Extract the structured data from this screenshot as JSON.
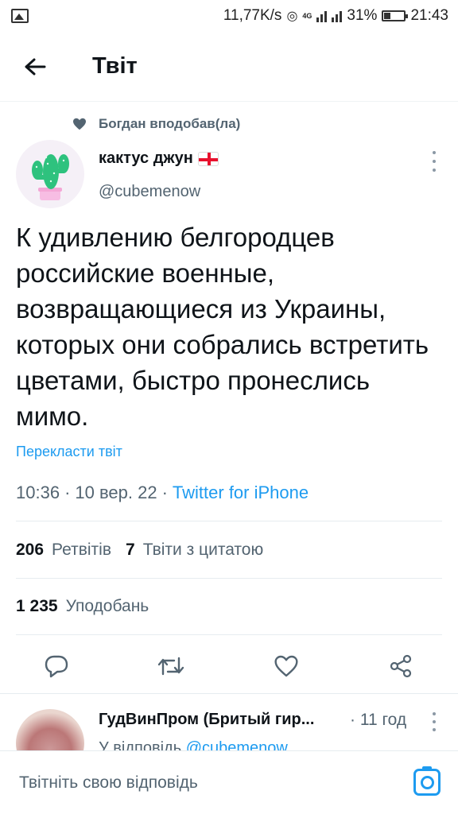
{
  "status_bar": {
    "speed": "11,77K/s",
    "network": "4G",
    "battery": "31%",
    "time": "21:43"
  },
  "header": {
    "title": "Твіт"
  },
  "social_context": {
    "text": "Богдан вподобав(ла)"
  },
  "tweet": {
    "author_name": "кактус джун",
    "author_handle": "@cubemenow",
    "text": "К удивлению белгородцев российские военные, возвращающиеся из Украины, которых они собрались встретить цветами, быстро пронеслись мимо.",
    "translate_label": "Перекласти твіт",
    "time": "10:36",
    "date": "10 вер. 22",
    "source": "Twitter for iPhone",
    "sep": "·"
  },
  "stats": {
    "retweets_count": "206",
    "retweets_label": "Ретвітів",
    "quotes_count": "7",
    "quotes_label": "Твіти з цитатою",
    "likes_count": "1 235",
    "likes_label": "Уподобань"
  },
  "reply": {
    "author_name": "ГудВинПром (Бритый гир...",
    "time": "· 11 год",
    "reply_prefix": "У відповідь",
    "reply_handle": "@cubemenow"
  },
  "compose": {
    "placeholder": "Твітніть свою відповідь"
  },
  "colors": {
    "accent": "#1d9bf0",
    "secondary_text": "#536471",
    "primary_text": "#0f1419"
  }
}
